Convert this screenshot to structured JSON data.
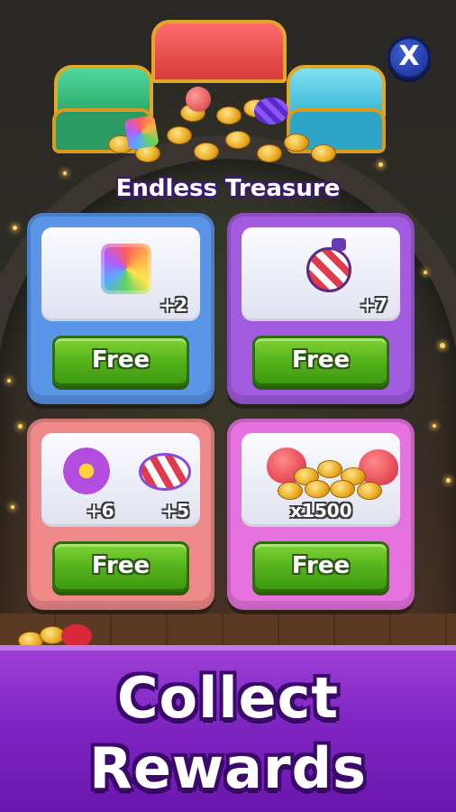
{
  "title": "Endless Treasure",
  "close_button": {
    "label": "X"
  },
  "rewards": [
    {
      "id": "rainbow-cube",
      "items": [
        {
          "icon": "rainbow-cube-icon",
          "amount": "+2"
        }
      ],
      "button": "Free",
      "card_color": "#5a95e8"
    },
    {
      "id": "bomb",
      "items": [
        {
          "icon": "bomb-icon",
          "amount": "+7"
        }
      ],
      "button": "Free",
      "card_color": "#a35be0"
    },
    {
      "id": "flower-candy",
      "items": [
        {
          "icon": "flower-icon",
          "amount": "+6"
        },
        {
          "icon": "striped-candy-icon",
          "amount": "+5"
        }
      ],
      "button": "Free",
      "card_color": "#f08a8a"
    },
    {
      "id": "hearts-coins",
      "items": [
        {
          "icon": "hearts-coins-icon",
          "amount": "x1500"
        }
      ],
      "button": "Free",
      "card_color": "#e672df"
    }
  ],
  "banner": {
    "line1": "Collect",
    "line2": "Rewards"
  },
  "colors": {
    "banner": "#7f25c2",
    "button_green": "#52b01a",
    "title_outline": "#3b1a6e"
  }
}
